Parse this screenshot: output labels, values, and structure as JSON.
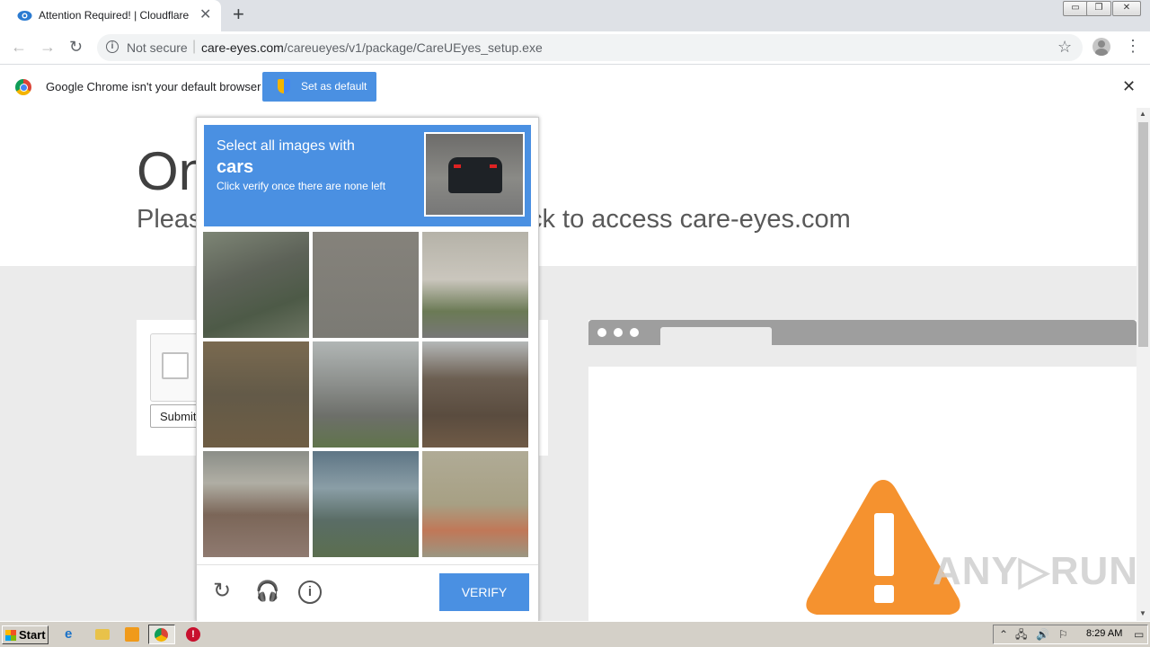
{
  "tab": {
    "title": "Attention Required! | Cloudflare",
    "close": "✕",
    "new_tab": "+"
  },
  "window_controls": {
    "minimize": "▭",
    "maximize": "❐",
    "close": "✕"
  },
  "toolbar": {
    "back": "←",
    "forward": "→",
    "reload": "↻",
    "security_label": "Not secure",
    "separator": "|",
    "url_host": "care-eyes.com",
    "url_path": "/careueyes/v1/package/CareUEyes_setup.exe",
    "star": "☆",
    "menu": "⋮"
  },
  "infobar": {
    "message": "Google Chrome isn't your default browser",
    "button_label": "Set as default",
    "close": "✕"
  },
  "page": {
    "headline": "On",
    "subline_left": "Pleas",
    "subline_right": "ck to access care-eyes.com",
    "submit_label": "Submit"
  },
  "challenge": {
    "instruction_line1": "Select all images with",
    "target": "cars",
    "instruction_line2": "Click verify once there are none left",
    "verify_label": "VERIFY",
    "reload_icon": "↻",
    "audio_icon": "🎧",
    "about_icon": "i"
  },
  "watermark": "ANY▷RUN",
  "taskbar": {
    "start_label": "Start",
    "clock": "8:29 AM",
    "tray_icons": [
      "⌃",
      "🖧",
      "🔊",
      "⚐",
      "▭"
    ]
  },
  "colors": {
    "accent": "#4a90e2",
    "warning": "#f5922f"
  }
}
